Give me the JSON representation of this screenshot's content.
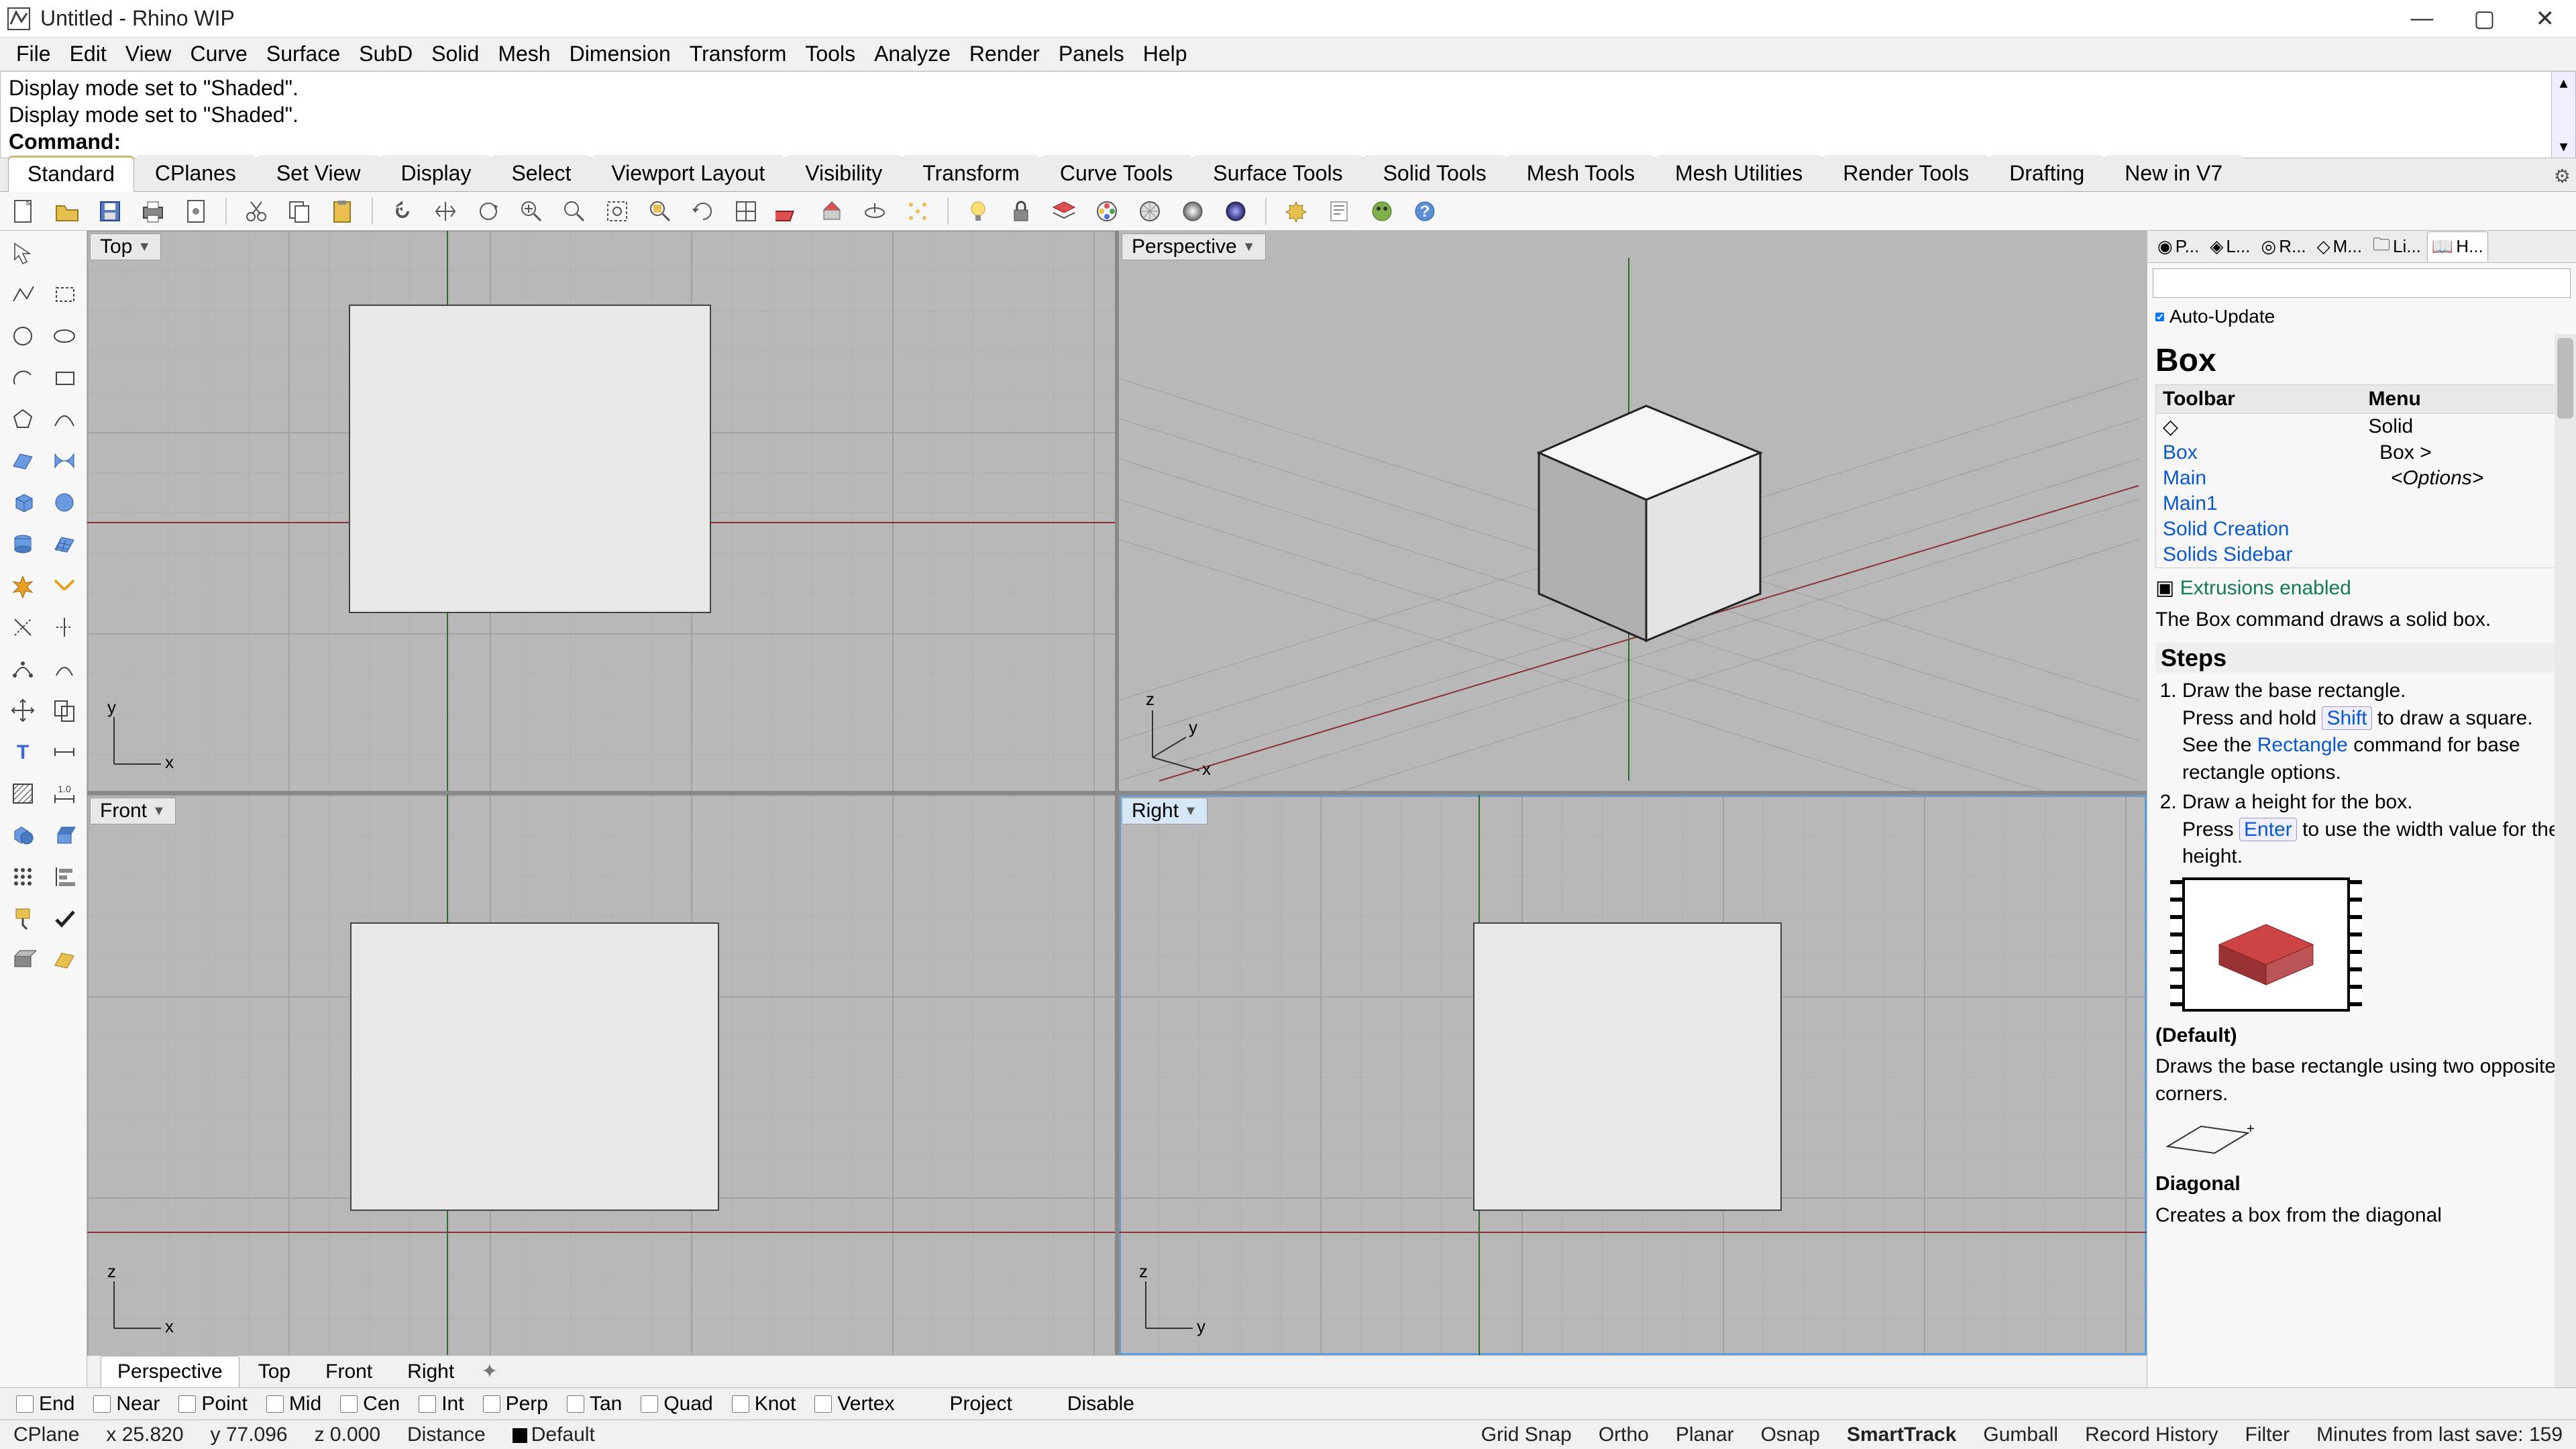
{
  "window": {
    "title": "Untitled - Rhino WIP"
  },
  "menu": [
    "File",
    "Edit",
    "View",
    "Curve",
    "Surface",
    "SubD",
    "Solid",
    "Mesh",
    "Dimension",
    "Transform",
    "Tools",
    "Analyze",
    "Render",
    "Panels",
    "Help"
  ],
  "command_history": [
    "Display mode set to \"Shaded\".",
    "Display mode set to \"Shaded\"."
  ],
  "command_prompt": "Command:",
  "toolbar_tabs": [
    "Standard",
    "CPlanes",
    "Set View",
    "Display",
    "Select",
    "Viewport Layout",
    "Visibility",
    "Transform",
    "Curve Tools",
    "Surface Tools",
    "Solid Tools",
    "Mesh Tools",
    "Mesh Utilities",
    "Render Tools",
    "Drafting",
    "New in V7"
  ],
  "active_toolbar_tab": "Standard",
  "viewports": {
    "top": "Top",
    "perspective": "Perspective",
    "front": "Front",
    "right": "Right"
  },
  "viewport_tabs": [
    "Perspective",
    "Top",
    "Front",
    "Right"
  ],
  "active_viewport": "Perspective",
  "right_panel": {
    "tabs": [
      "P...",
      "L...",
      "R...",
      "M...",
      "Li...",
      "H..."
    ],
    "auto_update": "Auto-Update",
    "title": "Box",
    "col_tool": "Toolbar",
    "col_menu": "Menu",
    "toolbar_links": [
      "Box",
      "Main",
      "Main1",
      "Solid Creation",
      "Solids Sidebar"
    ],
    "menu_links": [
      "Solid",
      "Box >",
      "<Options>"
    ],
    "extrusions": "Extrusions enabled",
    "desc": "The Box command draws a solid box.",
    "steps_hdr": "Steps",
    "step1a": "Draw the base rectangle.",
    "step1b_pre": "Press and hold ",
    "step1b_kbd": "Shift",
    "step1b_post": " to draw a square.",
    "step1c_pre": "See the ",
    "step1c_link": "Rectangle",
    "step1c_post": " command for base rectangle options.",
    "step2a": "Draw a height for the box.",
    "step2b_pre": "Press ",
    "step2b_kbd": "Enter",
    "step2b_post": " to use the width value for the height.",
    "default_hdr": "(Default)",
    "default_body": "Draws the base rectangle using two opposite corners.",
    "diag_hdr": "Diagonal",
    "diag_body": "Creates a box from the diagonal"
  },
  "osnap": {
    "items": [
      "End",
      "Near",
      "Point",
      "Mid",
      "Cen",
      "Int",
      "Perp",
      "Tan",
      "Quad",
      "Knot",
      "Vertex"
    ],
    "project": "Project",
    "disable": "Disable"
  },
  "status": {
    "cplane": "CPlane",
    "x": "x 25.820",
    "y": "y 77.096",
    "z": "z 0.000",
    "distance": "Distance",
    "layer": "Default",
    "toggles": [
      "Grid Snap",
      "Ortho",
      "Planar",
      "Osnap",
      "SmartTrack",
      "Gumball",
      "Record History",
      "Filter"
    ],
    "bold_toggle": "SmartTrack",
    "save": "Minutes from last save: 159"
  }
}
